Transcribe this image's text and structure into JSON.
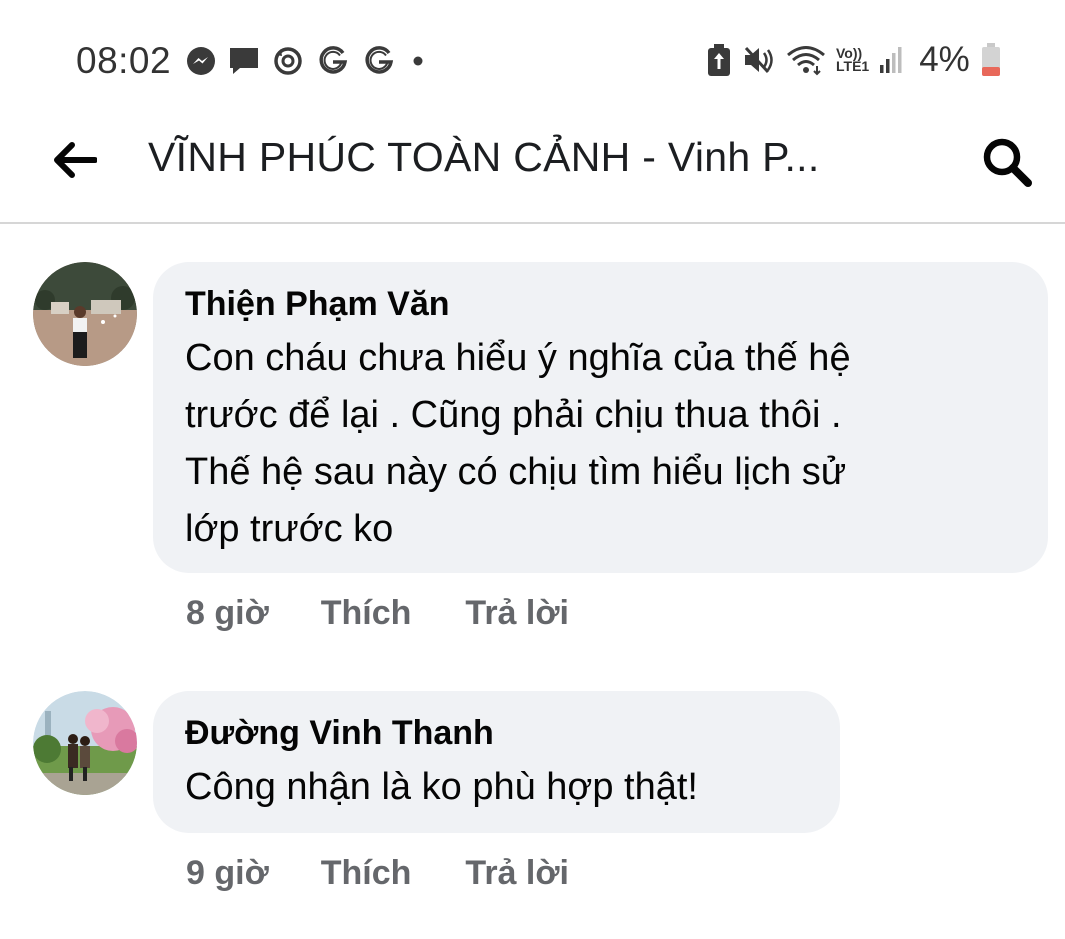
{
  "status_bar": {
    "time": "08:02",
    "left_icons": [
      "messenger-icon",
      "chat-bubble-icon",
      "sync-icon",
      "g-icon",
      "g-icon",
      "dot-icon"
    ],
    "right_icons": [
      "battery-saver-icon",
      "mute-icon",
      "wifi-icon",
      "volte-lte-icon",
      "signal-icon"
    ],
    "volte_label": "Vo))",
    "lte_label": "LTE1",
    "battery_percent": "4%",
    "battery_color": "#e8685a"
  },
  "header": {
    "title": "VĨNH PHÚC TOÀN CẢNH - Vinh P...",
    "back_icon": "back-arrow-icon",
    "search_icon": "search-icon"
  },
  "comments": [
    {
      "author": "Thiện Phạm Văn",
      "lines": [
        "Con cháu chưa hiểu ý nghĩa của thế hệ",
        "trước để lại . Cũng phải chịu thua thôi .",
        "Thế hệ sau này có chịu tìm hiểu lịch sử",
        "lớp trước ko"
      ],
      "time": "8 giờ",
      "like_label": "Thích",
      "reply_label": "Trả lời"
    },
    {
      "author": "Đường Vinh Thanh",
      "lines": [
        "Công nhận là ko phù hợp thật!"
      ],
      "time": "9 giờ",
      "like_label": "Thích",
      "reply_label": "Trả lời"
    }
  ],
  "colors": {
    "bubble": "#f0f2f5",
    "meta_text": "#65676b",
    "divider": "#d6d6d6"
  }
}
